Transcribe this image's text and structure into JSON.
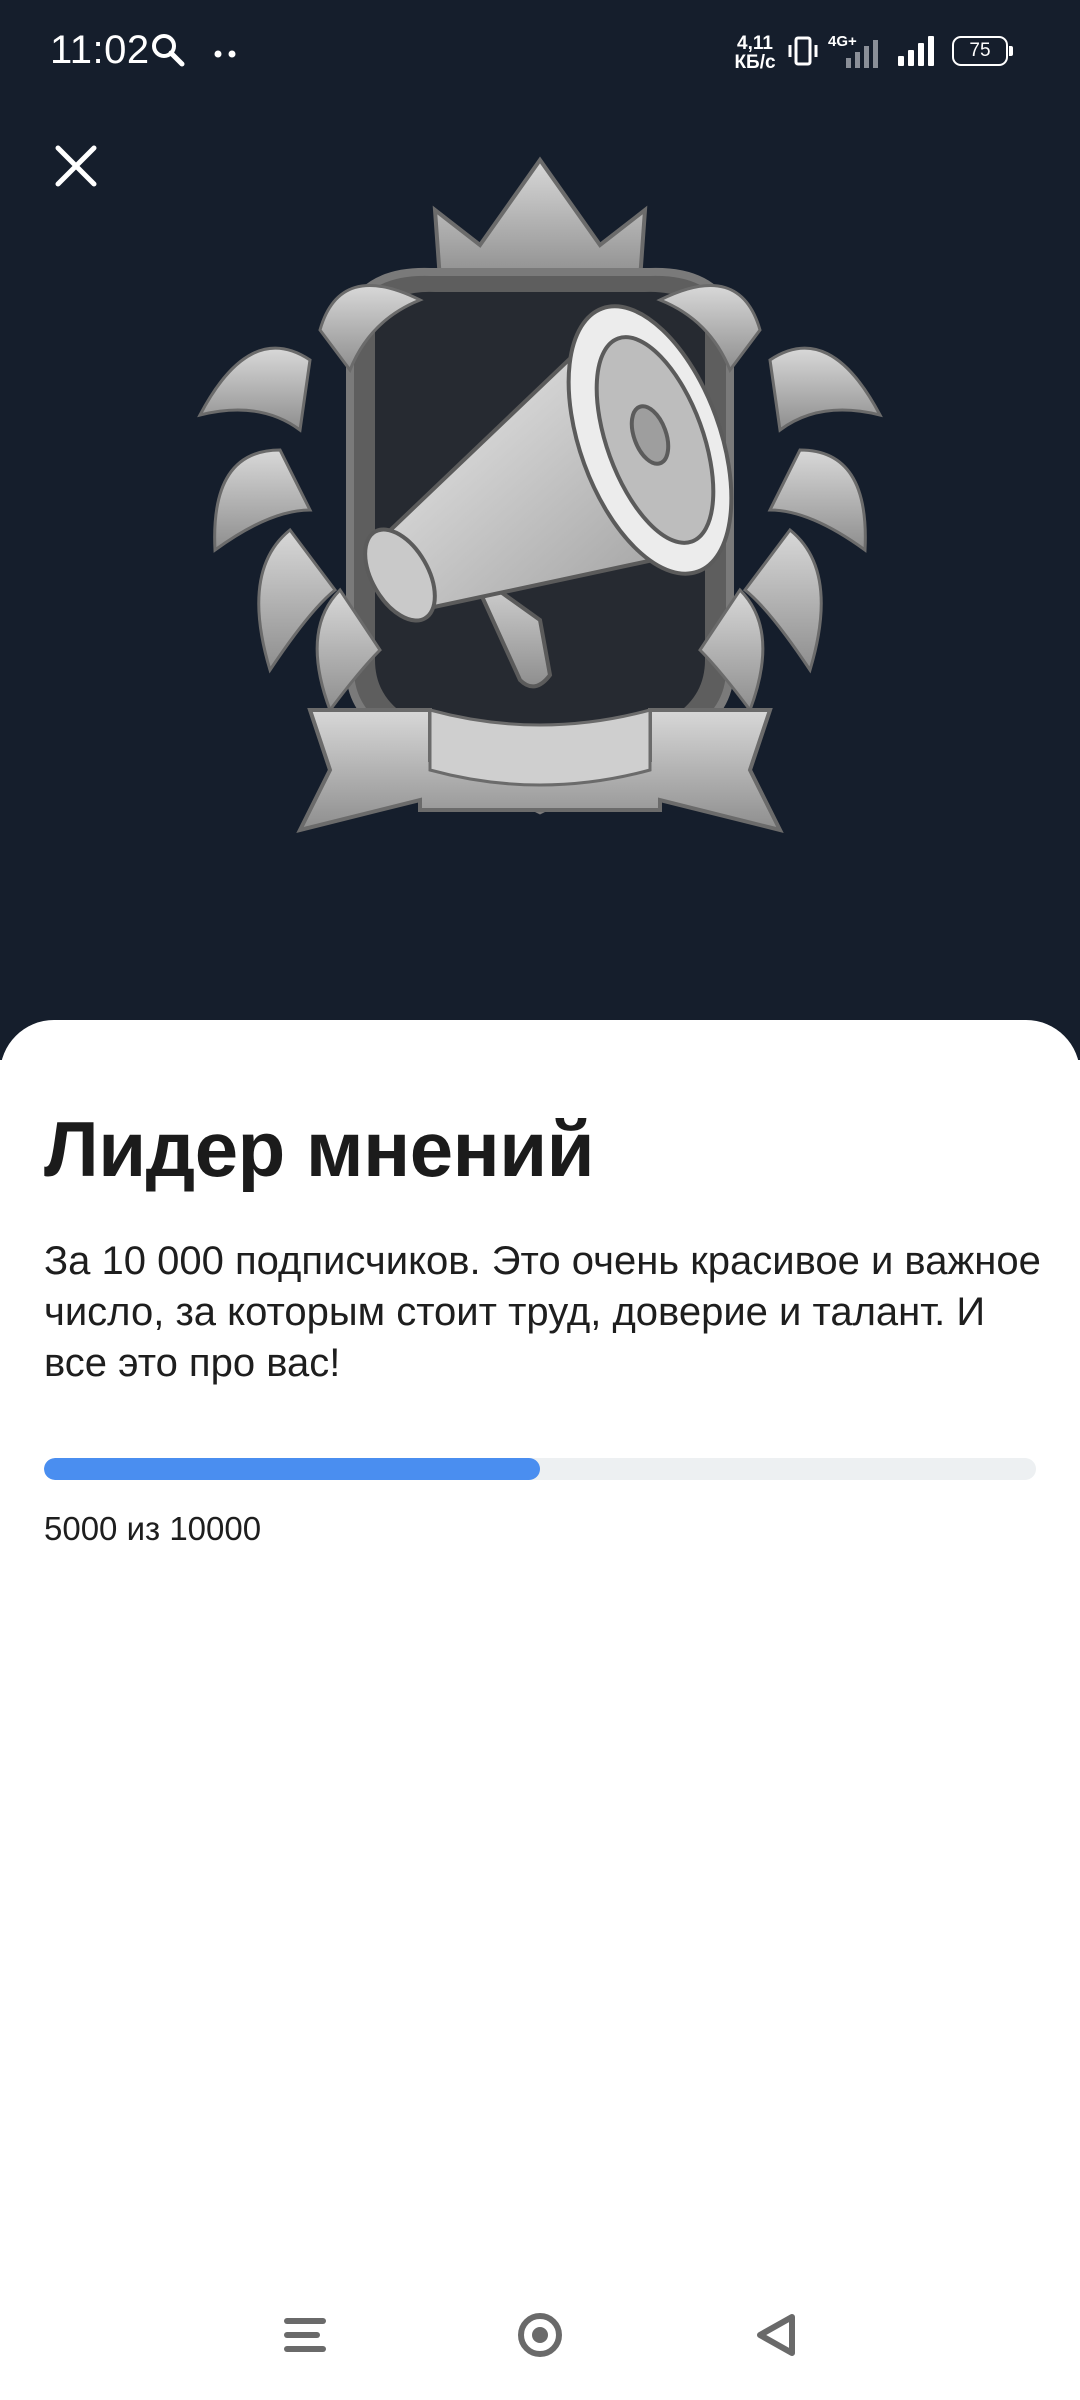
{
  "status_bar": {
    "time": "11:02",
    "net_speed_value": "4,11",
    "net_speed_unit": "КБ/с",
    "network_type": "4G+",
    "battery_level": "75"
  },
  "icons": {
    "close": "close-icon",
    "badge": "megaphone-crest-icon",
    "nav_menu": "menu-icon",
    "nav_home": "home-icon",
    "nav_back": "back-icon"
  },
  "achievement": {
    "title": "Лидер мнений",
    "description": "За 10 000 подписчиков. Это очень красивое и важное число, за которым стоит труд, доверие и талант. И все это про вас!",
    "progress_text": "5000 из 10000",
    "progress_current": 5000,
    "progress_total": 10000
  },
  "colors": {
    "hero_background": "#151e2c",
    "progress_fill": "#4a8ef0",
    "progress_track": "#edf0f2",
    "badge_silver": "#b9b9b9"
  }
}
